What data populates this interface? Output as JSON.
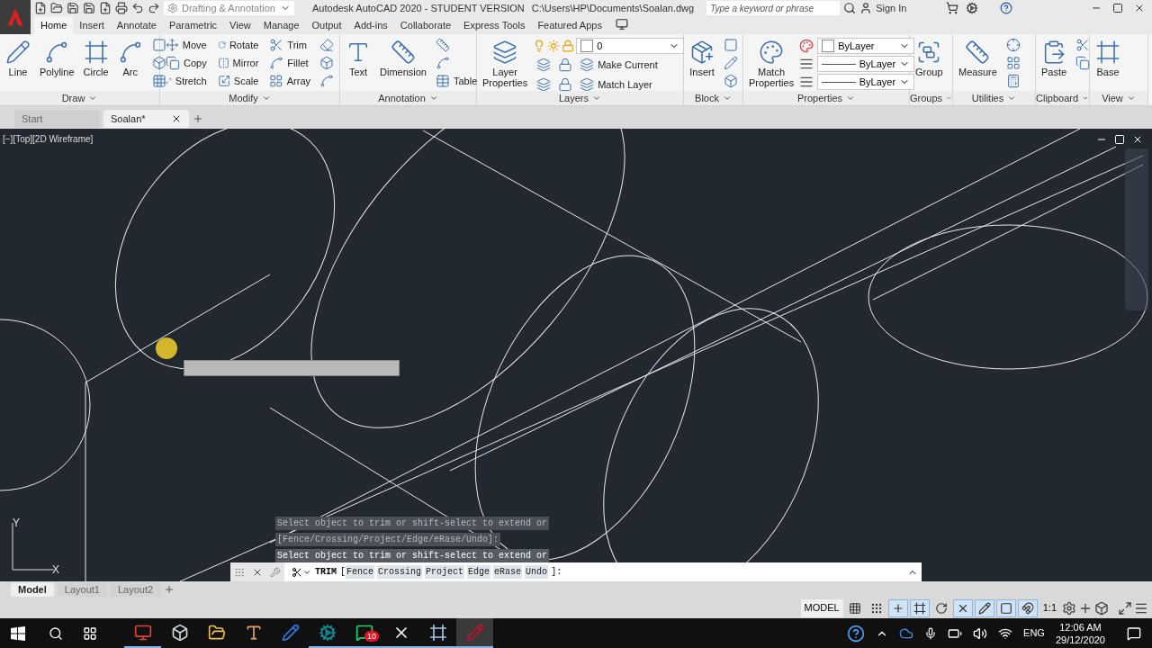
{
  "title_bar": {
    "workspace": "Drafting & Annotation",
    "title": "Autodesk AutoCAD 2020 - STUDENT VERSION",
    "path": "C:\\Users\\HP\\Documents\\Soalan.dwg",
    "search_placeholder": "Type a keyword or phrase",
    "sign_in": "Sign In"
  },
  "ribbon_tabs": [
    {
      "label": "Home",
      "selected": true
    },
    {
      "label": "Insert",
      "selected": false
    },
    {
      "label": "Annotate",
      "selected": false
    },
    {
      "label": "Parametric",
      "selected": false
    },
    {
      "label": "View",
      "selected": false
    },
    {
      "label": "Manage",
      "selected": false
    },
    {
      "label": "Output",
      "selected": false
    },
    {
      "label": "Add-ins",
      "selected": false
    },
    {
      "label": "Collaborate",
      "selected": false
    },
    {
      "label": "Express Tools",
      "selected": false
    },
    {
      "label": "Featured Apps",
      "selected": false
    }
  ],
  "panels": {
    "draw": {
      "title": "Draw",
      "tools": [
        "Line",
        "Polyline",
        "Circle",
        "Arc"
      ]
    },
    "modify": {
      "title": "Modify",
      "tools": [
        "Move",
        "Rotate",
        "Trim",
        "Copy",
        "Mirror",
        "Fillet",
        "Stretch",
        "Scale",
        "Array"
      ]
    },
    "annotation": {
      "title": "Annotation",
      "tools": [
        "Text",
        "Dimension",
        "Table"
      ]
    },
    "layers": {
      "title": "Layers",
      "tools": [
        "Layer Properties",
        "Make Current",
        "Match Layer"
      ],
      "layer": "0"
    },
    "block": {
      "title": "Block",
      "tools": [
        "Insert"
      ]
    },
    "properties": {
      "title": "Properties",
      "tools": [
        "Match Properties"
      ],
      "values": [
        "ByLayer",
        "ByLayer",
        "ByLayer"
      ]
    },
    "groups": {
      "title": "Groups",
      "tools": [
        "Group"
      ]
    },
    "utilities": {
      "title": "Utilities",
      "tools": [
        "Measure"
      ]
    },
    "clipboard": {
      "title": "Clipboard",
      "tools": [
        "Paste"
      ]
    },
    "view": {
      "title": "View",
      "tools": [
        "Base"
      ]
    }
  },
  "file_tabs": [
    {
      "label": "Start",
      "selected": false
    },
    {
      "label": "Soalan*",
      "selected": true
    }
  ],
  "viewport_label": "[−][Top][2D Wireframe]",
  "ucs": {
    "y": "Y",
    "x": "X"
  },
  "command_history": [
    {
      "text": "Select object to trim or shift-select to extend or",
      "current": false
    },
    {
      "text": "[Fence/Crossing/Project/Edge/eRase/Undo]:",
      "current": false
    },
    {
      "text": "Select object to trim or shift-select to extend or",
      "current": true
    }
  ],
  "command_line": {
    "command": "TRIM",
    "open": "[",
    "options": [
      "Fence",
      "Crossing",
      "Project",
      "Edge",
      "eRase",
      "Undo"
    ],
    "close": "]:"
  },
  "layout_tabs": [
    {
      "label": "Model",
      "selected": true
    },
    {
      "label": "Layout1",
      "selected": false
    },
    {
      "label": "Layout2",
      "selected": false
    }
  ],
  "status_bar": {
    "space": "MODEL",
    "scale": "1:1",
    "toggles": [
      {
        "on": false
      },
      {
        "on": false
      },
      {
        "on": true
      },
      {
        "on": true
      },
      {
        "on": false
      },
      {
        "on": true
      },
      {
        "on": true
      },
      {
        "on": true
      },
      {
        "on": true
      }
    ]
  },
  "taskbar": {
    "apps": [
      {
        "running": true,
        "active": false
      },
      {
        "running": false,
        "active": false
      },
      {
        "running": false,
        "active": false
      },
      {
        "running": false,
        "active": false
      },
      {
        "running": false,
        "active": false
      },
      {
        "running": true,
        "active": false
      },
      {
        "running": true,
        "active": false,
        "badge": "10"
      },
      {
        "running": true,
        "active": false
      },
      {
        "running": true,
        "active": false
      },
      {
        "running": true,
        "active": true
      }
    ],
    "language": "ENG",
    "time": "12:06 AM",
    "date": "29/12/2020"
  }
}
